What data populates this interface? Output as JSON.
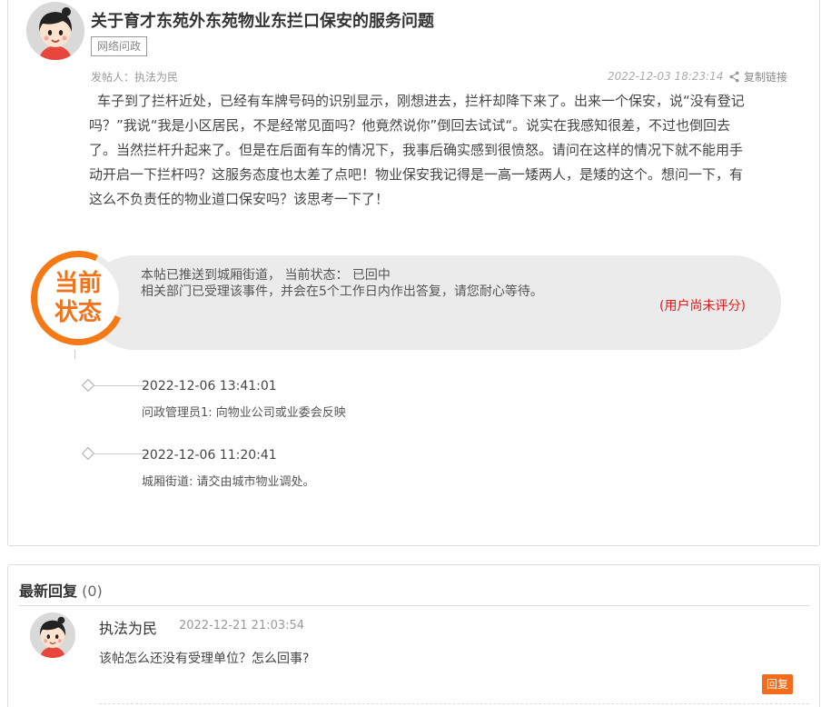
{
  "post": {
    "title": "关于育才东苑外东苑物业东拦口保安的服务问题",
    "tag": "网络问政",
    "poster": "发帖人：执法为民",
    "time": "2022-12-03 18:23:14",
    "share_label": "复制链接",
    "body": "车子到了拦杆近处，已经有车牌号码的识别显示，刚想进去，拦杆却降下来了。出来一个保安，说“没有登记吗？”我说“我是小区居民，不是经常见面吗？他竟然说你”倒回去试试“。说实在我感知很差，不过也倒回去了。当然拦杆升起来了。但是在后面有车的情况下，我事后确实感到很愤怒。请问在这样的情况下就不能用手动开启一下拦杆吗？这服务态度也太差了点吧！物业保安我记得是一高一矮两人，是矮的这个。想问一下，有这么不负责任的物业道口保安吗？该思考一下了！"
  },
  "status": {
    "badge_line1": "当前",
    "badge_line2": "状态",
    "line1": "本帖已推送到城厢街道， 当前状态： 已回中",
    "line2": "相关部门已受理该事件，并会在5个工作日内作出答复，请您耐心等待。",
    "rating_note": "(用户尚未评分)",
    "accent_color": "#f47a15"
  },
  "timeline": [
    {
      "time": "2022-12-06 13:41:01",
      "desc": "问政管理员1: 向物业公司或业委会反映"
    },
    {
      "time": "2022-12-06 11:20:41",
      "desc": "城厢街道: 请交由城市物业调处。"
    }
  ],
  "replies": {
    "header": "最新回复",
    "count": "(0)",
    "items": [
      {
        "author": "执法为民",
        "time": "2022-12-21 21:03:54",
        "text": "该帖怎么还没有受理单位？怎么回事?",
        "reply_button": "回复"
      }
    ]
  }
}
